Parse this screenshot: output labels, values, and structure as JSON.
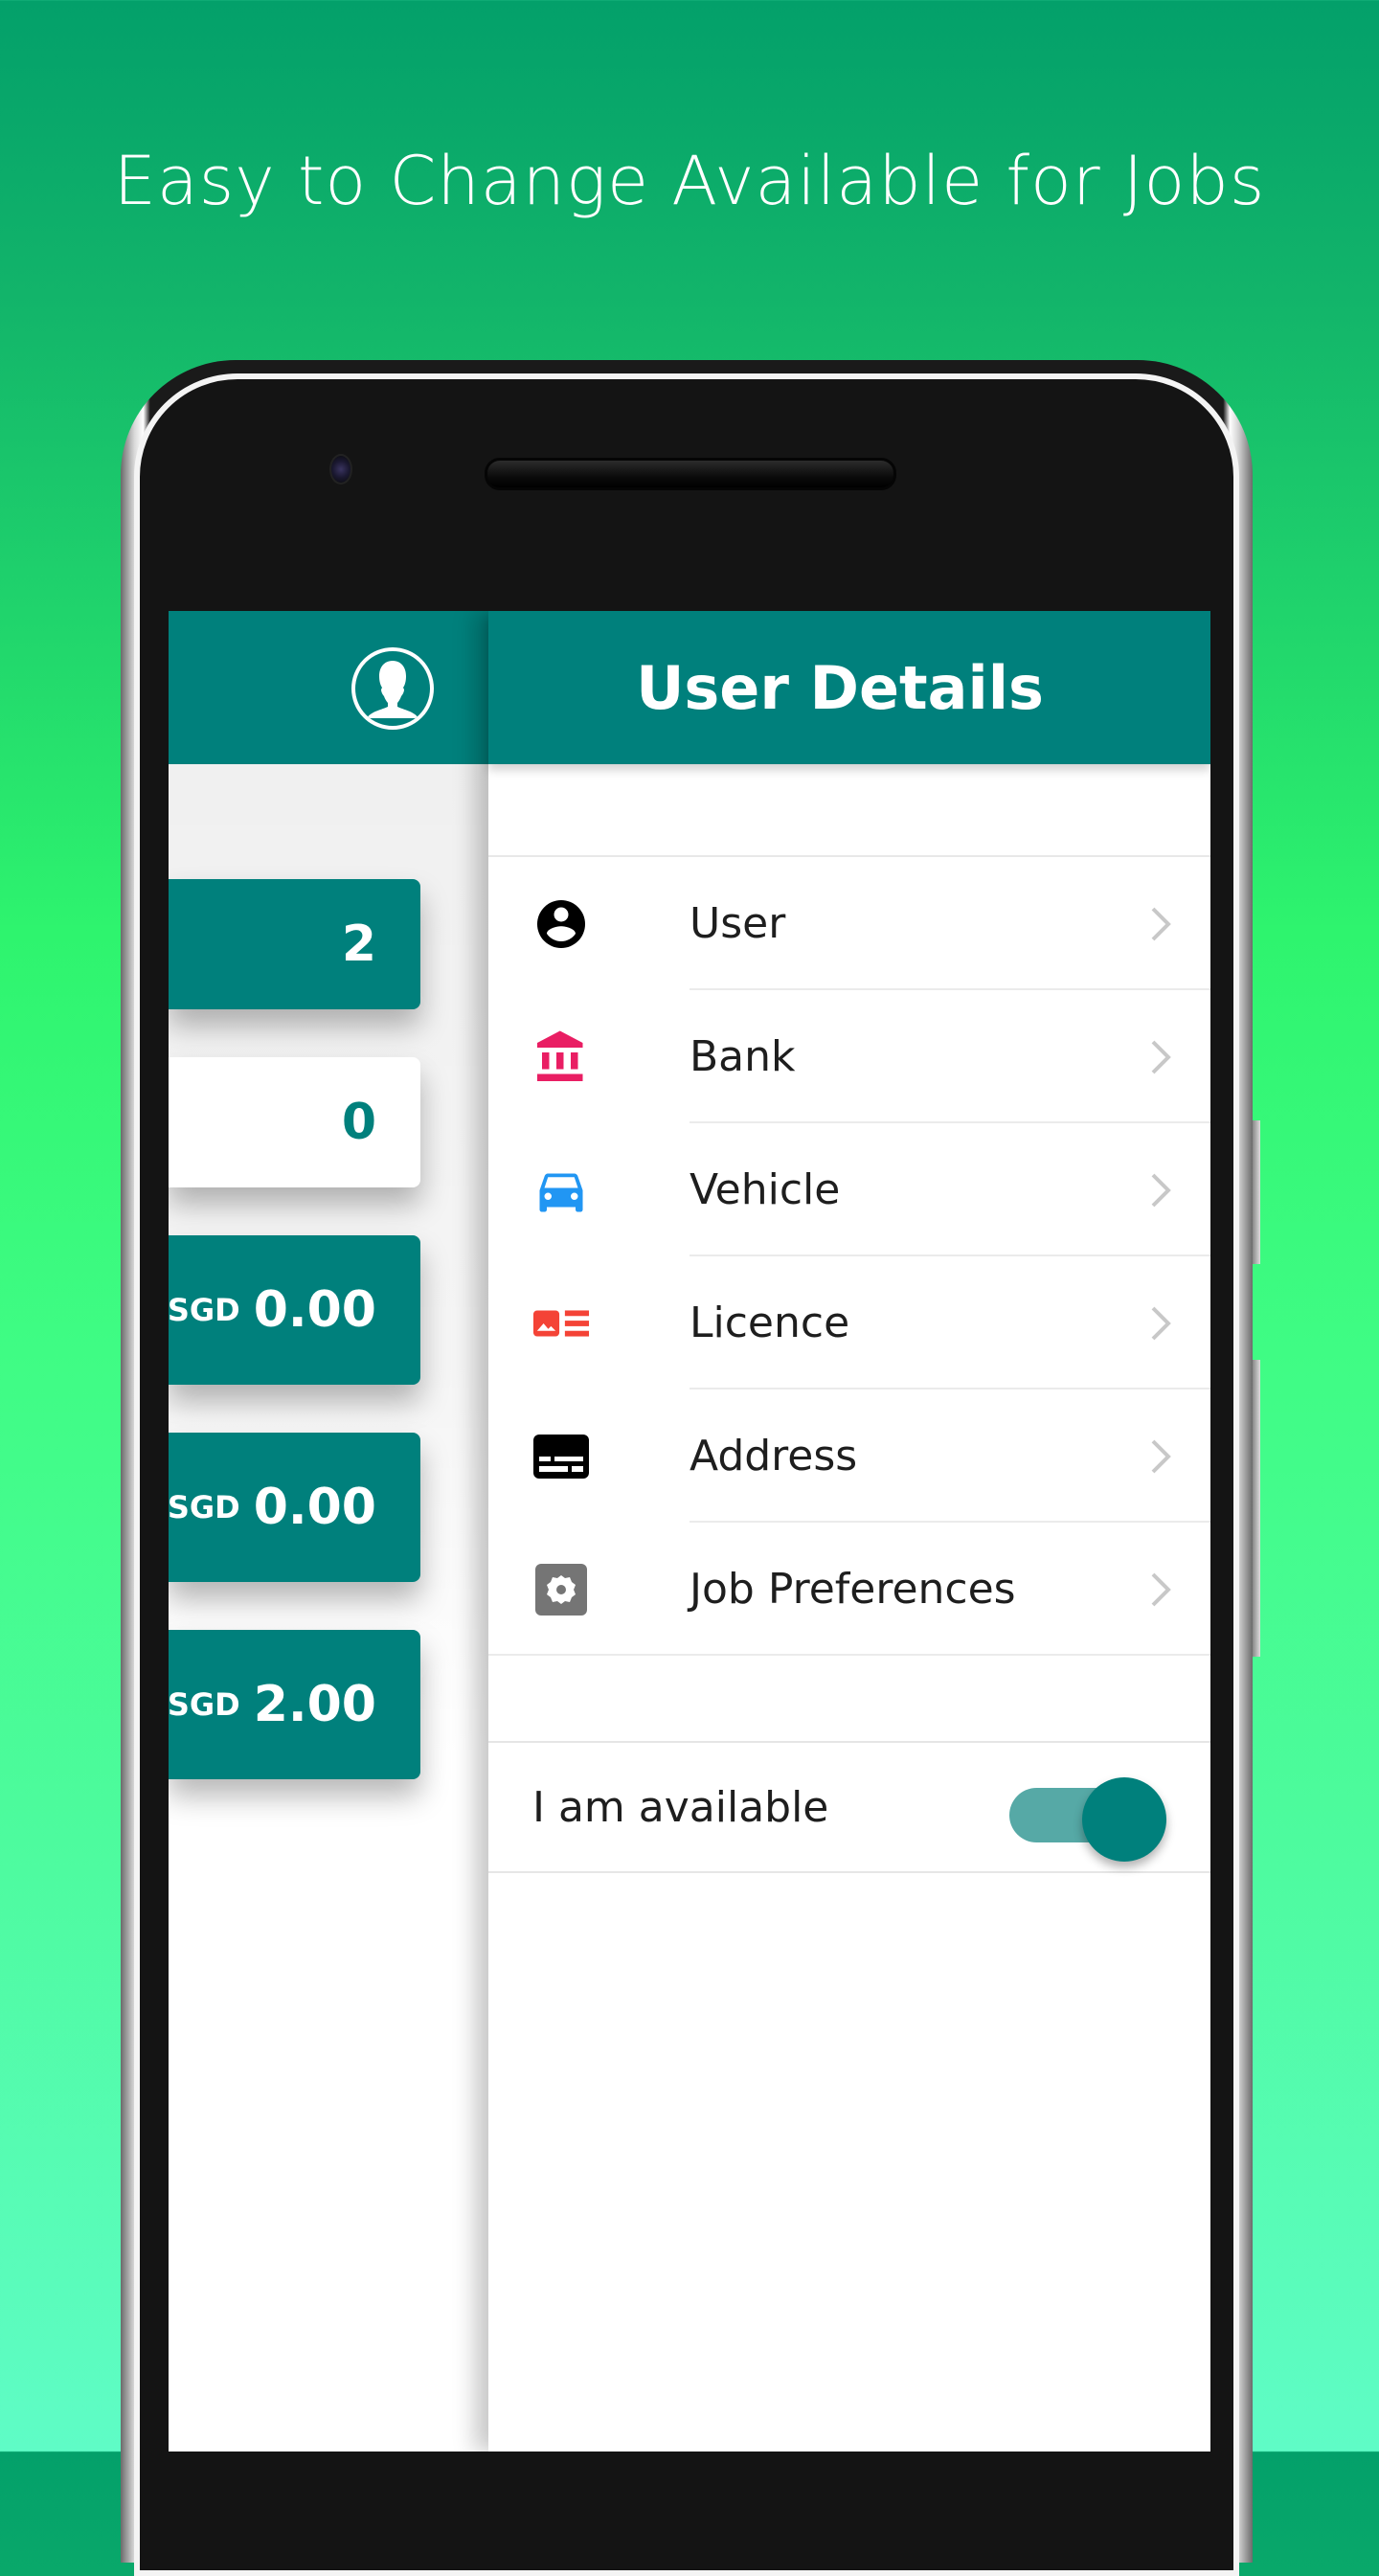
{
  "headline": "Easy to Change Available for Jobs",
  "back_panel": {
    "stats": [
      {
        "value": "2",
        "currency": "",
        "style": "teal"
      },
      {
        "value": "0",
        "currency": "",
        "style": "white"
      },
      {
        "value": "0.00",
        "currency": "SGD",
        "style": "teal"
      },
      {
        "value": "0.00",
        "currency": "SGD",
        "style": "teal"
      },
      {
        "value": "2.00",
        "currency": "SGD",
        "style": "teal"
      }
    ],
    "avatar_icon": "person-silhouette-icon"
  },
  "user_details": {
    "title": "User Details",
    "menu": [
      {
        "label": "User",
        "icon": "account-circle-icon",
        "icon_color": "#000000"
      },
      {
        "label": "Bank",
        "icon": "bank-icon",
        "icon_color": "#e91e63"
      },
      {
        "label": "Vehicle",
        "icon": "car-icon",
        "icon_color": "#2196f3"
      },
      {
        "label": "Licence",
        "icon": "license-card-icon",
        "icon_color": "#f44336"
      },
      {
        "label": "Address",
        "icon": "address-card-icon",
        "icon_color": "#000000"
      },
      {
        "label": "Job Preferences",
        "icon": "settings-gear-icon",
        "icon_color": "#757575"
      }
    ],
    "availability": {
      "label": "I am available",
      "enabled": true
    }
  },
  "colors": {
    "primary": "#00807c",
    "toggle_track": "#56a9a6",
    "chevron": "#c8c8c8"
  }
}
